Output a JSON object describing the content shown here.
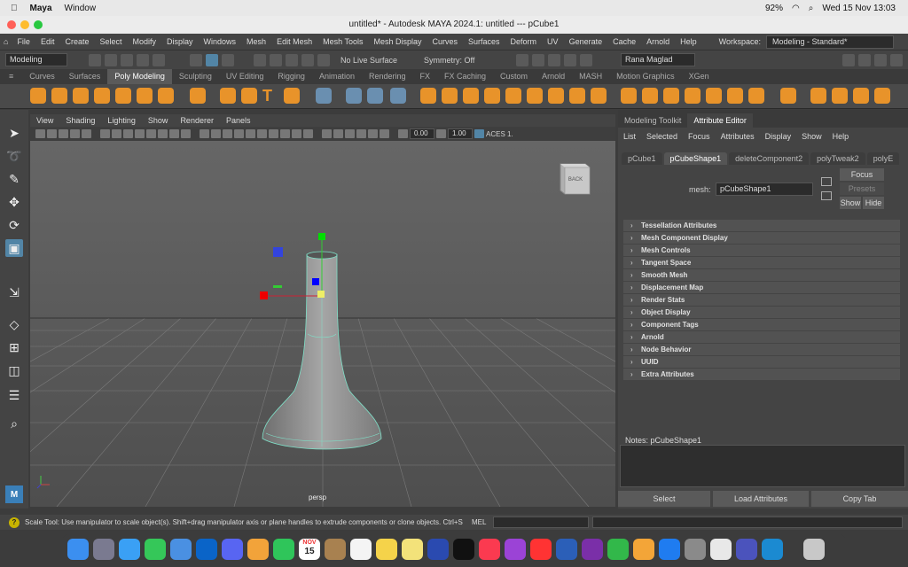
{
  "mac_menu": {
    "app": "Maya",
    "window": "Window",
    "battery": "92%",
    "clock": "Wed 15 Nov  13:03"
  },
  "title": "untitled* - Autodesk MAYA 2024.1: untitled   ---   pCube1",
  "menus": [
    "File",
    "Edit",
    "Create",
    "Select",
    "Modify",
    "Display",
    "Windows",
    "Mesh",
    "Edit Mesh",
    "Mesh Tools",
    "Mesh Display",
    "Curves",
    "Surfaces",
    "Deform",
    "UV",
    "Generate",
    "Cache",
    "Arnold",
    "Help"
  ],
  "workspace_label": "Workspace:",
  "workspace_value": "Modeling - Standard*",
  "mode_select": "Modeling",
  "live_surface": "No Live Surface",
  "symmetry": "Symmetry: Off",
  "user": "Rana Maglad",
  "shelf_tabs": [
    "Curves",
    "Surfaces",
    "Poly Modeling",
    "Sculpting",
    "UV Editing",
    "Rigging",
    "Animation",
    "Rendering",
    "FX",
    "FX Caching",
    "Custom",
    "Arnold",
    "MASH",
    "Motion Graphics",
    "XGen"
  ],
  "viewport_menu": [
    "View",
    "Shading",
    "Lighting",
    "Show",
    "Renderer",
    "Panels"
  ],
  "vp_field1": "0.00",
  "vp_field2": "1.00",
  "vp_colorspace": "ACES 1.",
  "camera_label": "persp",
  "viewcube_label": "BACK",
  "ae_tabs": [
    "Modeling Toolkit",
    "Attribute Editor"
  ],
  "ae_menu": [
    "List",
    "Selected",
    "Focus",
    "Attributes",
    "Display",
    "Show",
    "Help"
  ],
  "node_tabs": [
    "pCube1",
    "pCubeShape1",
    "deleteComponent2",
    "polyTweak2",
    "polyE"
  ],
  "mesh_label": "mesh:",
  "mesh_value": "pCubeShape1",
  "focus_btn": "Focus",
  "presets_btn": "Presets",
  "show_btn": "Show",
  "hide_btn": "Hide",
  "sections": [
    "Tessellation Attributes",
    "Mesh Component Display",
    "Mesh Controls",
    "Tangent Space",
    "Smooth Mesh",
    "Displacement Map",
    "Render Stats",
    "Object Display",
    "Component Tags",
    "Arnold",
    "Node Behavior",
    "UUID",
    "Extra Attributes"
  ],
  "notes_label": "Notes:  pCubeShape1",
  "bottom_buttons": [
    "Select",
    "Load Attributes",
    "Copy Tab"
  ],
  "help_text": "Scale Tool: Use manipulator to scale object(s). Shift+drag manipulator axis or plane handles to extrude components or clone objects. Ctrl+Shif",
  "mel_label": "MEL",
  "dock_calendar_month": "NOV",
  "dock_calendar_day": "15"
}
